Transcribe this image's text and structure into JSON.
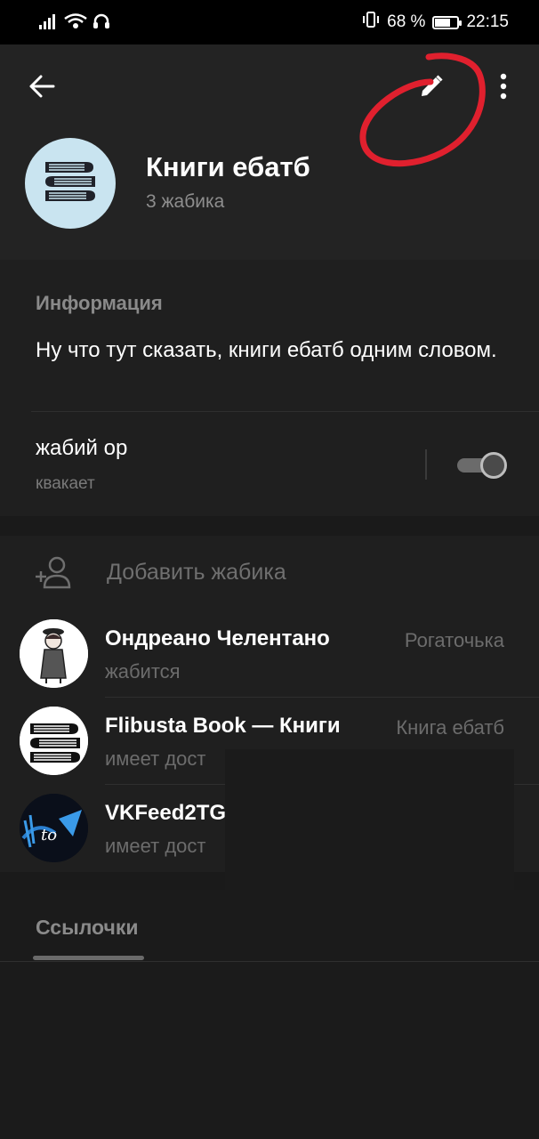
{
  "status_bar": {
    "battery_percent": "68 %",
    "battery_level": 0.68,
    "time": "22:15",
    "icons": [
      "signal-icon",
      "wifi-icon",
      "headset-icon",
      "vibrate-icon",
      "battery-icon"
    ]
  },
  "header": {
    "back_icon": "arrow-left-icon",
    "edit_icon": "pencil-icon",
    "more_icon": "dots-vertical-icon",
    "title": "Книги ебатб",
    "subtitle": "3 жабика",
    "avatar_icon": "books-stack-icon",
    "annotation_color": "#e0202e"
  },
  "info": {
    "heading": "Информация",
    "description": "Ну что тут сказать, книги ебатб одним словом.",
    "setting_title": "жабий ор",
    "setting_subtitle": "квакает",
    "toggle_on": true
  },
  "members": {
    "add_label": "Добавить жабика",
    "add_icon": "person-add-icon",
    "list": [
      {
        "name": "Ондреано Челентано",
        "status": "жабится",
        "role": "Рогаточька",
        "avatar": "character-avatar-icon"
      },
      {
        "name": "Flibusta Book — Книги",
        "status": "имеет дост",
        "role": "Книга ебатб",
        "avatar": "books-stack-icon"
      },
      {
        "name": "VKFeed2TG",
        "status": "имеет дост",
        "role": "",
        "avatar": "vkfeed-logo-icon"
      }
    ]
  },
  "links": {
    "heading": "Ссылочки"
  },
  "colors": {
    "background": "#1a1a1a",
    "header_bg": "#232323",
    "muted_text": "#8a8a8a",
    "avatar_blue": "#c9e4f0"
  }
}
